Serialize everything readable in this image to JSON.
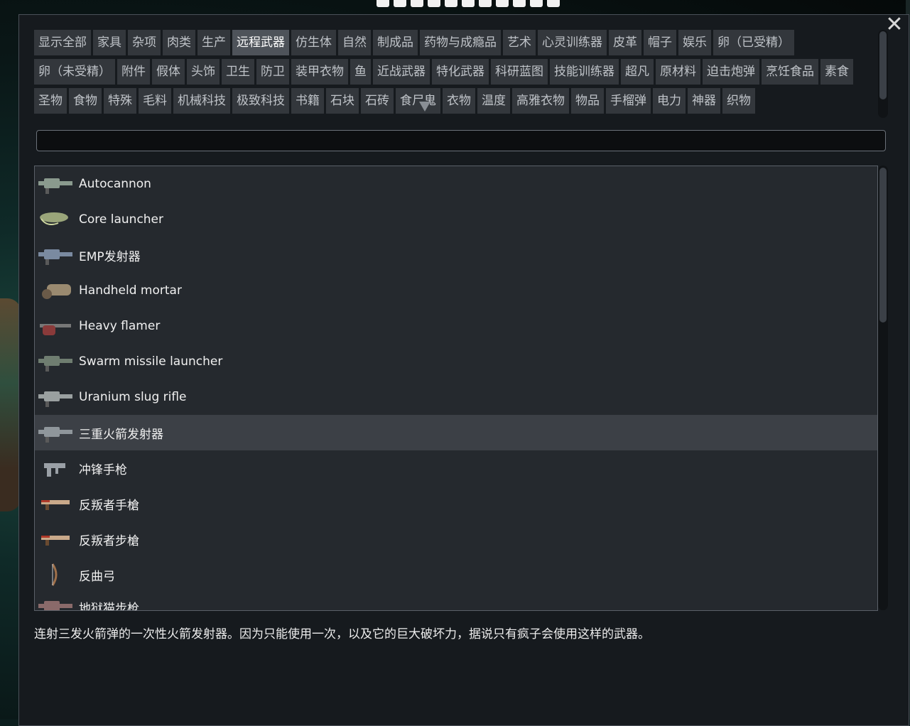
{
  "window": {
    "close_glyph": "✕"
  },
  "categories": [
    {
      "label": "显示全部"
    },
    {
      "label": "家具"
    },
    {
      "label": "杂项"
    },
    {
      "label": "肉类"
    },
    {
      "label": "生产"
    },
    {
      "label": "远程武器",
      "active": true
    },
    {
      "label": "仿生体"
    },
    {
      "label": "自然"
    },
    {
      "label": "制成品"
    },
    {
      "label": "药物与成瘾品"
    },
    {
      "label": "艺术"
    },
    {
      "label": "心灵训练器"
    },
    {
      "label": "皮革"
    },
    {
      "label": "帽子"
    },
    {
      "label": "娱乐"
    },
    {
      "label": "卵（已受精）"
    },
    {
      "label": "卵（未受精）"
    },
    {
      "label": "附件"
    },
    {
      "label": "假体"
    },
    {
      "label": "头饰"
    },
    {
      "label": "卫生"
    },
    {
      "label": "防卫"
    },
    {
      "label": "装甲衣物"
    },
    {
      "label": "鱼"
    },
    {
      "label": "近战武器"
    },
    {
      "label": "特化武器"
    },
    {
      "label": "科研蓝图"
    },
    {
      "label": "技能训练器"
    },
    {
      "label": "超凡"
    },
    {
      "label": "原材料"
    },
    {
      "label": "迫击炮弹"
    },
    {
      "label": "烹饪食品"
    },
    {
      "label": "素食"
    },
    {
      "label": "圣物"
    },
    {
      "label": "食物"
    },
    {
      "label": "特殊"
    },
    {
      "label": "毛料"
    },
    {
      "label": "机械科技"
    },
    {
      "label": "极致科技"
    },
    {
      "label": "书籍"
    },
    {
      "label": "石块"
    },
    {
      "label": "石砖"
    },
    {
      "label": "食尸鬼"
    },
    {
      "label": "衣物"
    },
    {
      "label": "温度"
    },
    {
      "label": "高雅衣物"
    },
    {
      "label": "物品"
    },
    {
      "label": "手榴弹"
    },
    {
      "label": "电力"
    },
    {
      "label": "神器"
    },
    {
      "label": "织物"
    }
  ],
  "search": {
    "value": ""
  },
  "items": [
    {
      "label": "Autocannon",
      "icon": "autocannon-icon",
      "color": "#8a9a8e"
    },
    {
      "label": "Core launcher",
      "icon": "core-launcher-icon",
      "color": "#9aa57a"
    },
    {
      "label": "EMP发射器",
      "icon": "emp-launcher-icon",
      "color": "#7a8aa0"
    },
    {
      "label": "Handheld mortar",
      "icon": "handheld-mortar-icon",
      "color": "#9a8a70"
    },
    {
      "label": "Heavy flamer",
      "icon": "heavy-flamer-icon",
      "color": "#8a3a3a"
    },
    {
      "label": "Swarm missile launcher",
      "icon": "swarm-missile-launcher-icon",
      "color": "#6f7d70"
    },
    {
      "label": "Uranium slug rifle",
      "icon": "uranium-slug-rifle-icon",
      "color": "#9aa0a0"
    },
    {
      "label": "三重火箭发射器",
      "icon": "triple-rocket-launcher-icon",
      "color": "#8f969b",
      "selected": true
    },
    {
      "label": "冲锋手枪",
      "icon": "machine-pistol-icon",
      "color": "#9aa0a6"
    },
    {
      "label": "反叛者手槍",
      "icon": "rebel-pistol-icon",
      "color": "#c9a98a"
    },
    {
      "label": "反叛者步槍",
      "icon": "rebel-rifle-icon",
      "color": "#c9a98a"
    },
    {
      "label": "反曲弓",
      "icon": "recurve-bow-icon",
      "color": "#a0704a"
    },
    {
      "label": "地狱猫步枪",
      "icon": "hellcat-rifle-icon",
      "color": "#8a6a6a",
      "partial": true
    }
  ],
  "description": "连射三发火箭弹的一次性火箭发射器。因为只能使用一次，以及它的巨大破坏力，据说只有疯子会使用这样的武器。"
}
